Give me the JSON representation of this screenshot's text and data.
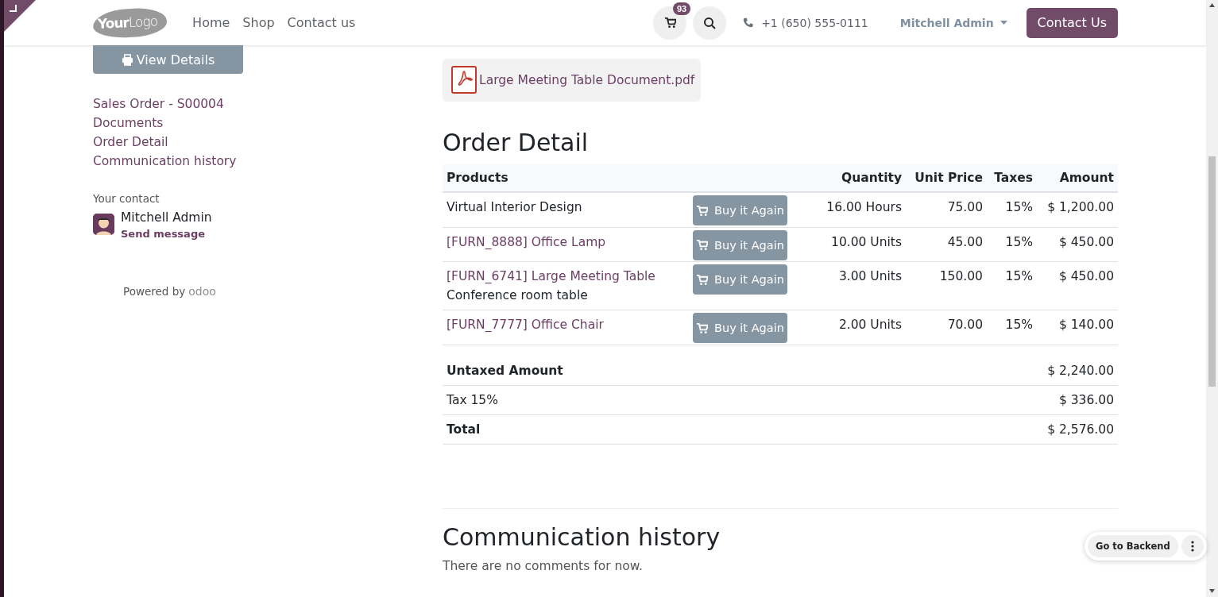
{
  "header": {
    "logo": {
      "word_1": "Your",
      "word_2": "Logo"
    },
    "nav": [
      {
        "label": "Home"
      },
      {
        "label": "Shop"
      },
      {
        "label": "Contact us"
      }
    ],
    "cart_count": "93",
    "phone": "+1 (650) 555-0111",
    "user": "Mitchell Admin",
    "cta": "Contact Us"
  },
  "sidebar": {
    "view_details": "View Details",
    "links": [
      {
        "label": "Sales Order - S00004"
      },
      {
        "label": "Documents"
      },
      {
        "label": "Order Detail"
      },
      {
        "label": "Communication history"
      }
    ],
    "contact_label": "Your contact",
    "contact_name": "Mitchell Admin",
    "send_message": "Send message",
    "powered_by": "Powered by",
    "powered_brand": "odoo"
  },
  "document": {
    "filename": "Large Meeting Table Document.pdf"
  },
  "order": {
    "title": "Order Detail",
    "columns": [
      "Products",
      "Quantity",
      "Unit Price",
      "Taxes",
      "Amount"
    ],
    "rows": [
      {
        "product": "Virtual Interior Design",
        "linked": false,
        "action": "Buy it Again",
        "quantity": "16.00 Hours",
        "unit_price": "75.00",
        "taxes": "15%",
        "amount": "$ 1,200.00"
      },
      {
        "product": "[FURN_8888] Office Lamp",
        "linked": true,
        "action": "Buy it Again",
        "quantity": "10.00 Units",
        "unit_price": "45.00",
        "taxes": "15%",
        "amount": "$ 450.00"
      },
      {
        "product": "[FURN_6741] Large Meeting Table",
        "description": "Conference room table",
        "linked": true,
        "action": "Buy it Again",
        "quantity": "3.00 Units",
        "unit_price": "150.00",
        "taxes": "15%",
        "amount": "$ 450.00"
      },
      {
        "product": "[FURN_7777] Office Chair",
        "linked": true,
        "action": "Buy it Again",
        "quantity": "2.00 Units",
        "unit_price": "70.00",
        "taxes": "15%",
        "amount": "$ 140.00"
      }
    ],
    "totals": [
      {
        "label": "Untaxed Amount",
        "value": "$ 2,240.00",
        "bold": true
      },
      {
        "label": "Tax 15%",
        "value": "$ 336.00",
        "bold": false
      },
      {
        "label": "Total",
        "value": "$ 2,576.00",
        "bold": true
      }
    ]
  },
  "communication": {
    "title": "Communication history",
    "empty_text": "There are no comments for now."
  },
  "backend_button": {
    "label": "Go to Backend"
  }
}
